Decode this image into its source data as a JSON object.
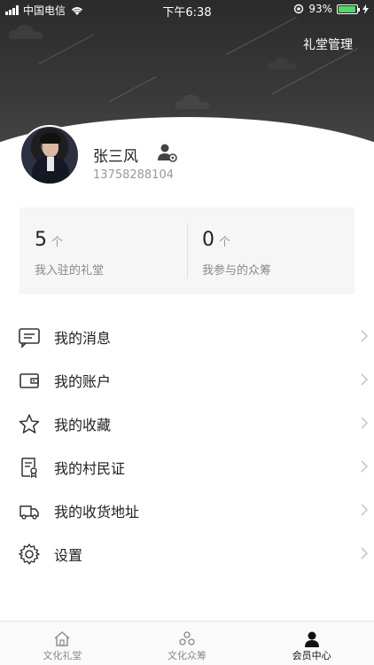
{
  "status_bar": {
    "carrier": "中国电信",
    "time": "下午6:38",
    "battery": "93%",
    "battery_level": 0.93
  },
  "header": {
    "manage_label": "礼堂管理"
  },
  "profile": {
    "name": "张三风",
    "phone": "13758288104"
  },
  "stats": [
    {
      "value": "5",
      "unit": "个",
      "label": "我入驻的礼堂"
    },
    {
      "value": "0",
      "unit": "个",
      "label": "我参与的众筹"
    }
  ],
  "menu": [
    {
      "label": "我的消息",
      "icon": "message-icon"
    },
    {
      "label": "我的账户",
      "icon": "wallet-icon"
    },
    {
      "label": "我的收藏",
      "icon": "star-icon"
    },
    {
      "label": "我的村民证",
      "icon": "certificate-icon"
    },
    {
      "label": "我的收货地址",
      "icon": "truck-icon"
    },
    {
      "label": "设置",
      "icon": "gear-icon"
    }
  ],
  "tabbar": [
    {
      "label": "文化礼堂",
      "icon": "home-icon",
      "active": false
    },
    {
      "label": "文化众筹",
      "icon": "crowdfund-icon",
      "active": false
    },
    {
      "label": "会员中心",
      "icon": "member-icon",
      "active": true
    }
  ]
}
